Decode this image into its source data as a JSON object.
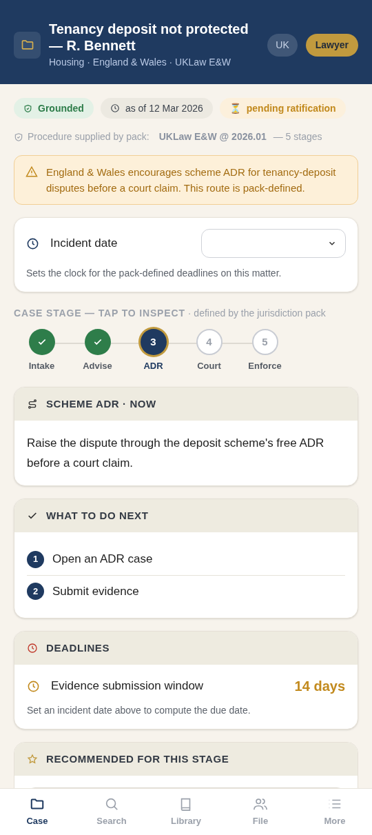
{
  "header": {
    "title": "Tenancy deposit not protected — R. Bennett",
    "subtitle": "Housing · England & Wales · UKLaw E&W",
    "region_badge": "UK",
    "role_badge": "Lawyer"
  },
  "chips": [
    {
      "kind": "grounded",
      "label": "Grounded"
    },
    {
      "kind": "date",
      "label": "as of 12 Mar 2026"
    },
    {
      "kind": "pending",
      "icon": "⏳",
      "label": "pending ratification"
    }
  ],
  "procedure": {
    "label": "Procedure supplied by pack:",
    "pack": "UKLaw E&W @ 2026.01",
    "stages": "— 5 stages"
  },
  "notice": "England & Wales encourages scheme ADR for tenancy-deposit disputes before a court claim. This route is pack-defined.",
  "incident": {
    "label": "Incident date",
    "hint": "Sets the clock for the pack-defined deadlines on this matter."
  },
  "stage_heading": {
    "title": "CASE STAGE — TAP TO INSPECT",
    "note": "· defined by the jurisdiction pack"
  },
  "stages": [
    {
      "label": "Intake",
      "done": true,
      "selected": false
    },
    {
      "label": "Advise",
      "done": true,
      "selected": false
    },
    {
      "label": "ADR",
      "number": "3",
      "done": false,
      "selected": true
    },
    {
      "label": "Court",
      "number": "4",
      "done": false,
      "selected": false
    },
    {
      "label": "Enforce",
      "number": "5",
      "done": false,
      "selected": false
    }
  ],
  "route_card": {
    "title": "SCHEME ADR · NOW",
    "body": "Raise the dispute through the deposit scheme's free ADR before a court claim."
  },
  "next_card": {
    "title": "WHAT TO DO NEXT",
    "steps": [
      {
        "number": "1",
        "label": "Open an ADR case"
      },
      {
        "number": "2",
        "label": "Submit evidence"
      }
    ]
  },
  "deadlines_card": {
    "title": "DEADLINES",
    "items": [
      {
        "label": "Evidence submission window",
        "value": "14 days",
        "note": "Set an incident date above to compute the due date."
      }
    ]
  },
  "recommended_card": {
    "title": "RECOMMENDED FOR THIS STAGE"
  },
  "nav": [
    {
      "kind": "case",
      "label": "Case",
      "selected": true
    },
    {
      "kind": "search",
      "label": "Search",
      "selected": false
    },
    {
      "kind": "library",
      "label": "Library",
      "selected": false
    },
    {
      "kind": "file",
      "label": "File",
      "selected": false
    },
    {
      "kind": "more",
      "label": "More",
      "selected": false
    }
  ]
}
